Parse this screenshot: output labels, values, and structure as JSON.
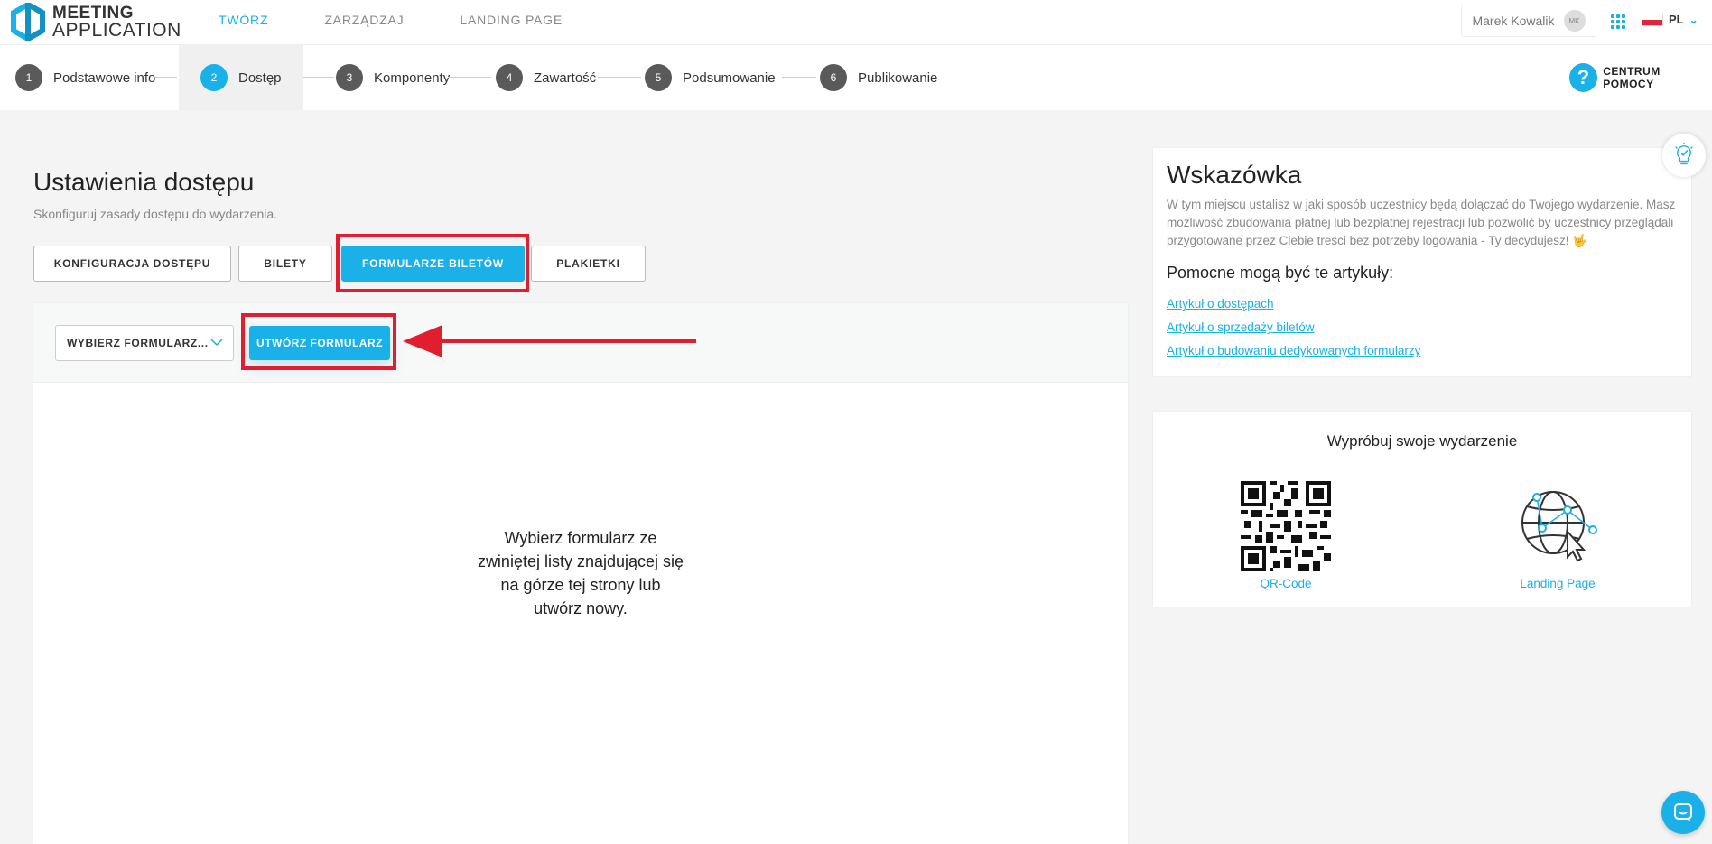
{
  "header": {
    "logo_line1": "MEETING",
    "logo_line2": "APPLICATION",
    "nav": [
      "TWÓRZ",
      "ZARZĄDZAJ",
      "LANDING PAGE"
    ],
    "user_name": "Marek Kowalik",
    "user_initials": "MK",
    "language": "PL"
  },
  "stepper": {
    "steps": [
      {
        "num": "1",
        "label": "Podstawowe info"
      },
      {
        "num": "2",
        "label": "Dostęp"
      },
      {
        "num": "3",
        "label": "Komponenty"
      },
      {
        "num": "4",
        "label": "Zawartość"
      },
      {
        "num": "5",
        "label": "Podsumowanie"
      },
      {
        "num": "6",
        "label": "Publikowanie"
      }
    ],
    "help_label": "CENTRUM POMOCY"
  },
  "main": {
    "title": "Ustawienia dostępu",
    "subtitle": "Skonfiguruj zasady dostępu do wydarzenia.",
    "tabs": [
      "KONFIGURACJA DOSTĘPU",
      "BILETY",
      "FORMULARZE BILETÓW",
      "PLAKIETKI"
    ],
    "select_label": "WYBIERZ FORMULARZ...",
    "create_button": "UTWÓRZ FORMULARZ",
    "empty_message": "Wybierz formularz ze zwiniętej listy znajdującej się na górze tej strony lub utwórz nowy."
  },
  "hint": {
    "title": "Wskazówka",
    "text": "W tym miejscu ustalisz w jaki sposób uczestnicy będą dołączać do Twojego wydarzenie. Masz możliwość zbudowania płatnej lub bezpłatnej rejestracji lub pozwolić by uczestnicy przeglądali przygotowane przez Ciebie treści bez potrzeby logowania - Ty decydujesz! 🤟",
    "subtitle": "Pomocne mogą być te artykuły:",
    "links": [
      "Artykuł o dostępach",
      "Artykuł o sprzedaży biletów",
      "Artykuł o budowaniu dedykowanych formularzy"
    ]
  },
  "try": {
    "title": "Wypróbuj swoje wydarzenie",
    "qr_label": "QR-Code",
    "landing_label": "Landing Page"
  },
  "colors": {
    "accent": "#1ab0e8",
    "highlight": "#e11d2e"
  }
}
